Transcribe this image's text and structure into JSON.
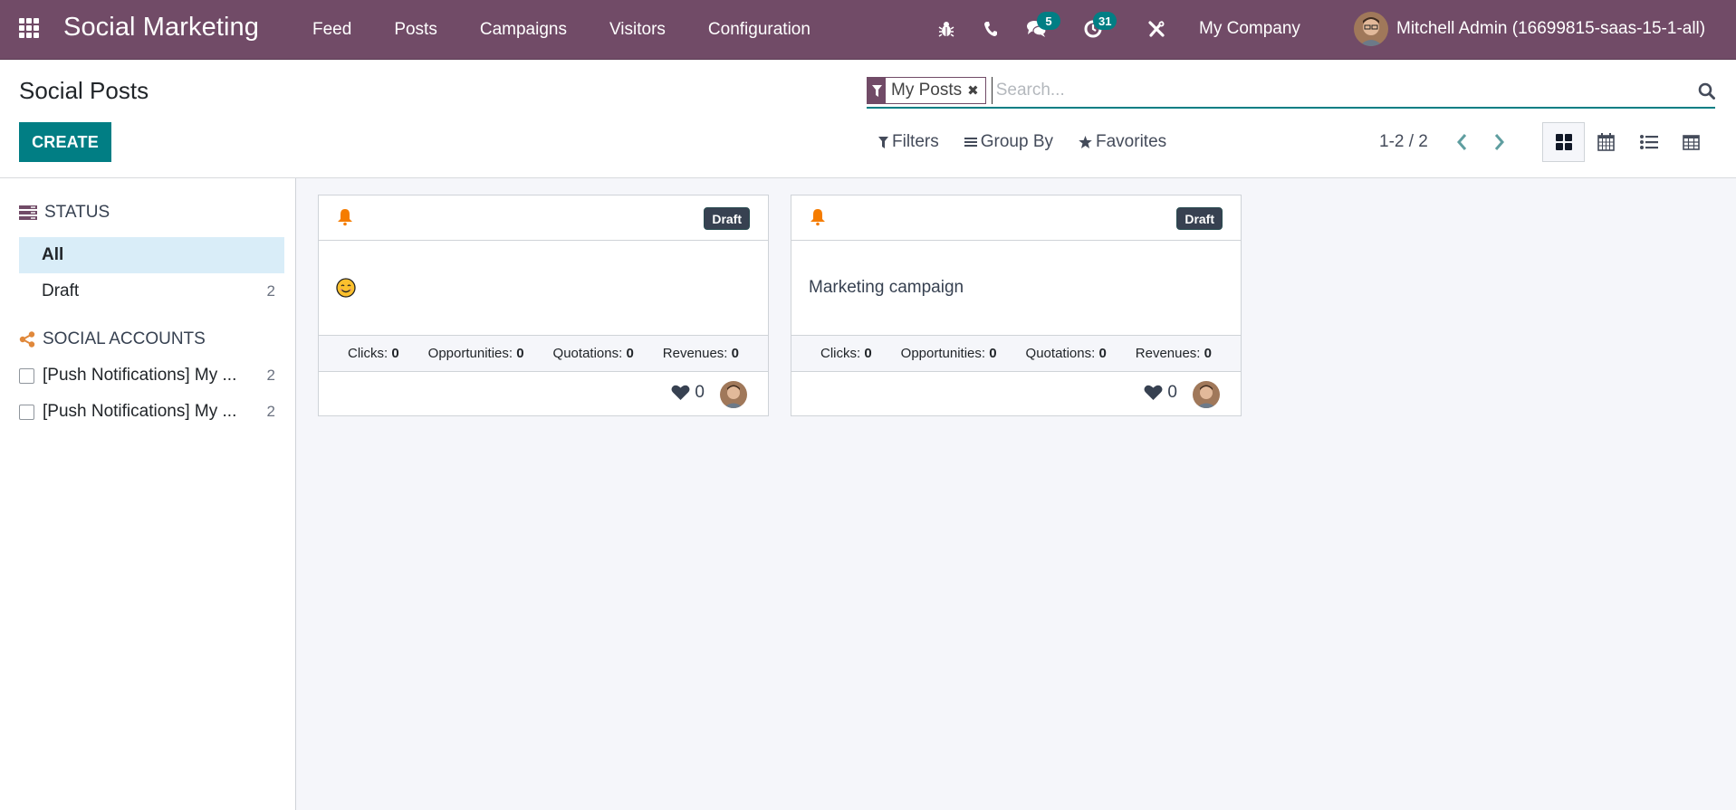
{
  "navbar": {
    "app_title": "Social Marketing",
    "menu": [
      "Feed",
      "Posts",
      "Campaigns",
      "Visitors",
      "Configuration"
    ],
    "systray": {
      "debug_icon": "bug-icon",
      "phone_icon": "phone-icon",
      "messages_icon": "comments-icon",
      "messages_count": "5",
      "activities_icon": "clock-icon",
      "activities_count": "31",
      "settings_icon": "tools-icon"
    },
    "company": "My Company",
    "user": "Mitchell Admin (16699815-saas-15-1-all)"
  },
  "control_panel": {
    "title": "Social Posts",
    "create_label": "CREATE",
    "search": {
      "facet_label": "My Posts",
      "facet_icon": "filter-icon",
      "placeholder": "Search...",
      "value": ""
    },
    "filters_label": "Filters",
    "group_by_label": "Group By",
    "favorites_label": "Favorites",
    "pager": "1-2 / 2",
    "views": [
      {
        "name": "kanban",
        "icon": "kanban-icon",
        "active": true
      },
      {
        "name": "calendar",
        "icon": "calendar-icon",
        "active": false
      },
      {
        "name": "list",
        "icon": "list-icon",
        "active": false
      },
      {
        "name": "pivot",
        "icon": "table-icon",
        "active": false
      }
    ]
  },
  "sidebar": {
    "status": {
      "header": "STATUS",
      "items": [
        {
          "label": "All",
          "count": "",
          "active": true
        },
        {
          "label": "Draft",
          "count": "2",
          "active": false
        }
      ]
    },
    "social_accounts": {
      "header": "SOCIAL ACCOUNTS",
      "items": [
        {
          "label": "[Push Notifications] My ...",
          "count": "2",
          "checked": false
        },
        {
          "label": "[Push Notifications] My ...",
          "count": "2",
          "checked": false
        }
      ]
    }
  },
  "cards": [
    {
      "media_icon": "bell-icon",
      "status": "Draft",
      "message": "😊",
      "stats": {
        "clicks_label": "Clicks:",
        "clicks": "0",
        "opportunities_label": "Opportunities:",
        "opportunities": "0",
        "quotations_label": "Quotations:",
        "quotations": "0",
        "revenues_label": "Revenues:",
        "revenues": "0"
      },
      "likes": "0"
    },
    {
      "media_icon": "bell-icon",
      "status": "Draft",
      "message": "Marketing campaign",
      "stats": {
        "clicks_label": "Clicks:",
        "clicks": "0",
        "opportunities_label": "Opportunities:",
        "opportunities": "0",
        "quotations_label": "Quotations:",
        "quotations": "0",
        "revenues_label": "Revenues:",
        "revenues": "0"
      },
      "likes": "0"
    }
  ],
  "colors": {
    "brand": "#714b67",
    "primary": "#017e84",
    "badge_dark": "#374151",
    "bell": "#f57c00",
    "active_filter_bg": "#d9edf8"
  }
}
